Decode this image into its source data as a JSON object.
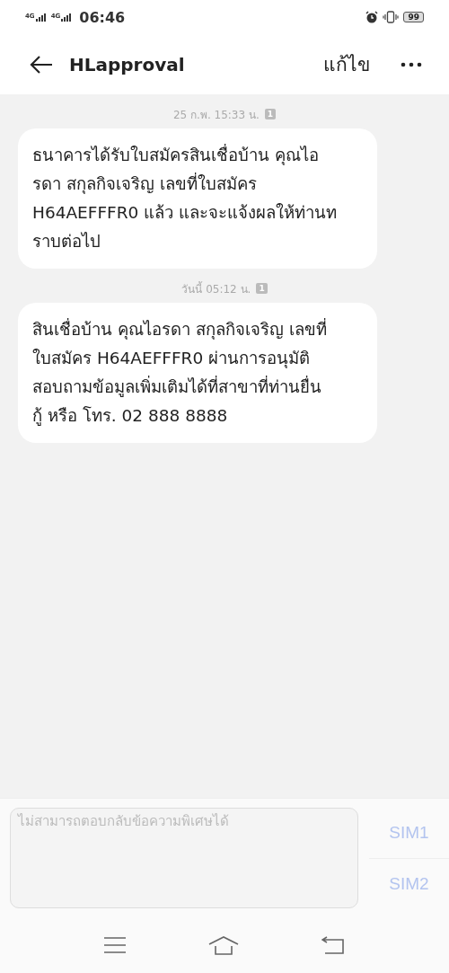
{
  "status_bar": {
    "networks": [
      "4G",
      "4G"
    ],
    "time": "06:46",
    "battery": "99"
  },
  "header": {
    "title": "HLapproval",
    "edit": "แก้ไข"
  },
  "messages": [
    {
      "timestamp": "25 ก.พ. 15:33 น.",
      "sim": "1",
      "lines": [
        "ธนาคารได้รับใบสมัครสินเชื่อบ้าน คุณไอ",
        "รดา สกุลกิจเจริญ เลขที่ใบสมัคร",
        "H64AEFFFR0 แล้ว และจะแจ้งผลให้ท่านท",
        "ราบต่อไป"
      ]
    },
    {
      "timestamp": "วันนี้ 05:12 น.",
      "sim": "1",
      "lines": [
        "สินเชื่อบ้าน คุณไอรดา สกุลกิจเจริญ เลขที่",
        "ใบสมัคร H64AEFFFR0 ผ่านการอนุมัติ",
        "สอบถามข้อมูลเพิ่มเติมได้ที่สาขาที่ท่านยื่น",
        "กู้ หรือ โทร. 02 888 8888"
      ]
    }
  ],
  "composer": {
    "placeholder": "ไม่สามารถตอบกลับข้อความพิเศษได้",
    "disabled": true,
    "sim_buttons": [
      "SIM1",
      "SIM2"
    ]
  }
}
